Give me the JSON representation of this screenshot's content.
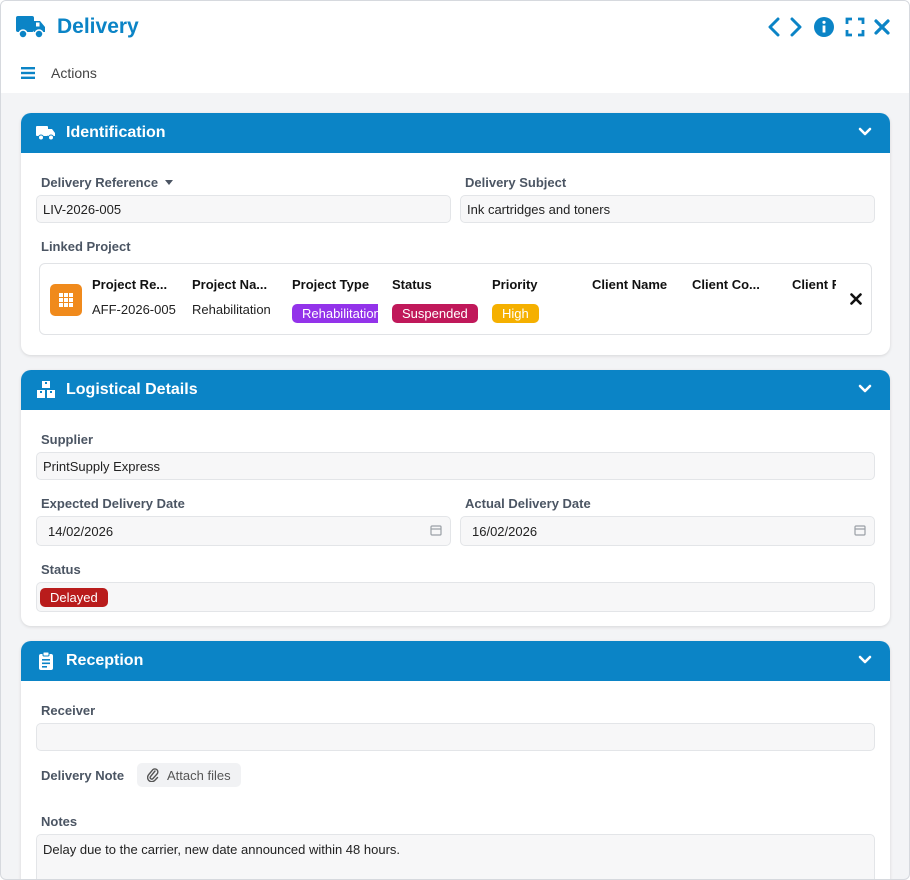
{
  "window": {
    "title": "Delivery",
    "icon": "truck-icon"
  },
  "toolbar": {
    "actions_label": "Actions"
  },
  "identification": {
    "title": "Identification",
    "reference_label": "Delivery Reference",
    "reference_value": "LIV-2026-005",
    "subject_label": "Delivery Subject",
    "subject_value": "Ink cartridges and toners",
    "linked_project_label": "Linked Project",
    "project": {
      "headers": [
        "Project Re...",
        "Project Na...",
        "Project Type",
        "Status",
        "Priority",
        "Client Name",
        "Client Co...",
        "Client F"
      ],
      "reference": "AFF-2026-005",
      "name": "Rehabilitation",
      "type": "Rehabilitation",
      "status": "Suspended",
      "priority": "High"
    }
  },
  "logistics": {
    "title": "Logistical Details",
    "supplier_label": "Supplier",
    "supplier_value": "PrintSupply Express",
    "expected_label": "Expected Delivery Date",
    "expected_value": "14/02/2026",
    "actual_label": "Actual Delivery Date",
    "actual_value": "16/02/2026",
    "status_label": "Status",
    "status_value": "Delayed"
  },
  "reception": {
    "title": "Reception",
    "receiver_label": "Receiver",
    "receiver_value": "",
    "note_label": "Delivery Note",
    "attach_label": "Attach files",
    "notes_label": "Notes",
    "notes_value": "Delay due to the carrier, new date announced within 48 hours."
  },
  "colors": {
    "accent": "#0b84c6",
    "badge_type": "#9333ea",
    "badge_suspended": "#c0185a",
    "badge_high": "#f5b000",
    "badge_delayed": "#b91c1c",
    "grid_icon": "#f08a1c"
  }
}
